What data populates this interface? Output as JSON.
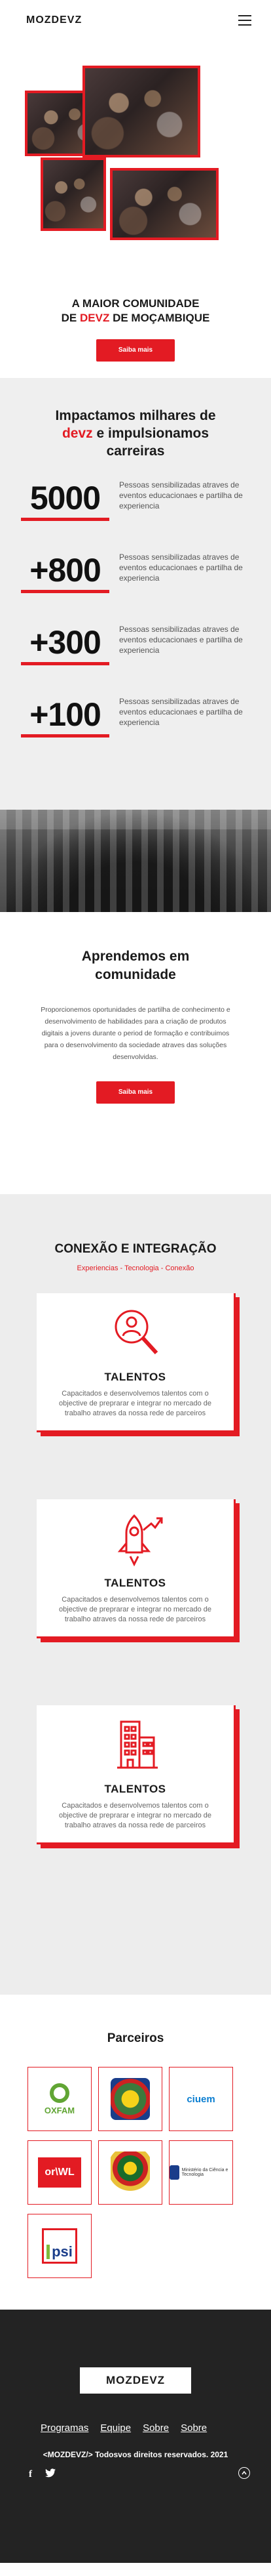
{
  "header": {
    "logo": "MOZDEVZ",
    "menu_icon": "hamburger-menu-icon"
  },
  "hero": {
    "title_line1": "A MAIOR COMUNIDADE",
    "title_line2_pre": "DE ",
    "title_line2_red": "DEVZ",
    "title_line2_post": " DE MOÇAMBIQUE",
    "button": "Saiba mais",
    "accent_color": "#e31b23"
  },
  "stats": {
    "title_pre": "Impactamos milhares de ",
    "title_red": "devz",
    "title_post": " e impulsionamos carreiras",
    "items": [
      {
        "number": "5000",
        "text": "Pessoas sensibilizadas atraves de eventos educacionaes e partilha de experiencia"
      },
      {
        "number": "+800",
        "text": "Pessoas sensibilizadas atraves de eventos educacionaes e partilha de experiencia"
      },
      {
        "number": "+300",
        "text": "Pessoas sensibilizadas atraves de eventos educacionaes e partilha de experiencia"
      },
      {
        "number": "+100",
        "text": "Pessoas sensibilizadas atraves de eventos educacionaes e partilha de experiencia"
      }
    ]
  },
  "learn": {
    "title": "Aprendemos em comunidade",
    "text": "Proporcionemos oportunidades de partilha de conhecimento e desenvolvimento de habilidades para a criação de produtos digitais a jovens durante o period de formação e contribuimos para o desenvolvimento da sociedade atraves das soluções desenvolvidas.",
    "button": "Saiba mais"
  },
  "connect": {
    "title": "CONEXÃO E INTEGRAÇÃO",
    "subtitle": "Experiencias - Tecnologia - Conexão",
    "cards": [
      {
        "icon": "magnifier-person-icon",
        "title": "TALENTOS",
        "text": "Capacitados e desenvolvemos talentos com o objective de preprarar e integrar no mercado de trabalho atraves da nossa rede de parceiros"
      },
      {
        "icon": "rocket-growth-icon",
        "title": "TALENTOS",
        "text": "Capacitados e desenvolvemos talentos com o objective de preprarar e integrar no mercado de trabalho atraves da nossa rede de parceiros"
      },
      {
        "icon": "office-building-icon",
        "title": "TALENTOS",
        "text": "Capacitados e desenvolvemos talentos com o objective de preprarar e integrar no mercado de trabalho atraves da nossa rede de parceiros"
      }
    ]
  },
  "partners": {
    "title": "Parceiros",
    "oxfam": "OXFAM",
    "ciuem": "ciuem",
    "orwl": "or\\WL",
    "gov_text": "Ministério da Ciência e Tecnologia",
    "psi": "psi"
  },
  "footer": {
    "logo": "MOZDEVZ",
    "nav": [
      "Programas",
      "Equipe",
      "Sobre",
      "Sobre"
    ],
    "copyright": "<MOZDEVZ/> Todosvos direitos  reservados. 2021",
    "facebook": "f"
  }
}
